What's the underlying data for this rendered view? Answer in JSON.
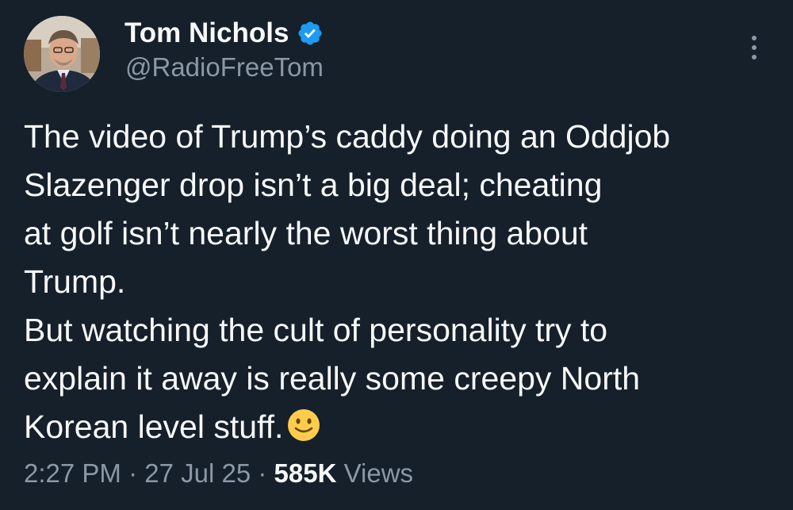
{
  "author": {
    "display_name": "Tom Nichols",
    "handle": "@RadioFreeTom",
    "verified": true,
    "avatar_icon": "profile-photo"
  },
  "tweet": {
    "lines": [
      "The video of Trump’s caddy doing an Oddjob",
      "Slazenger drop isn’t a big deal; cheating",
      "at golf isn’t nearly the worst thing about",
      "Trump.",
      "But watching the cult of personality try to",
      "explain it away is really some creepy North",
      "Korean level stuff."
    ],
    "emoji": "slightly-smiling-face"
  },
  "meta": {
    "time": "2:27 PM",
    "separator": "·",
    "date": "27 Jul 25",
    "views_count": "585K",
    "views_label": "Views"
  },
  "colors": {
    "background": "#15202b",
    "text": "#f7f9f9",
    "secondary": "#8b98a5",
    "verified_badge": "#1d9bf0"
  }
}
